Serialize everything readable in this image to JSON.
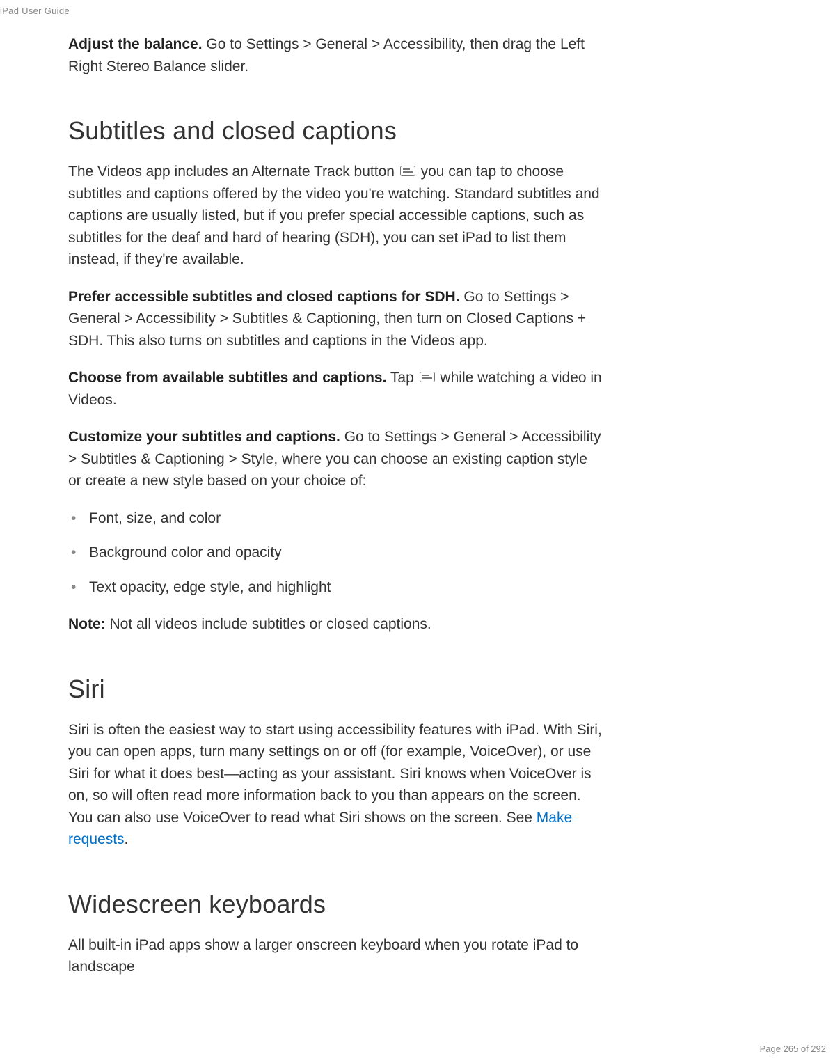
{
  "header": {
    "guide_label": "iPad User Guide"
  },
  "intro": {
    "adjust_balance_bold": "Adjust the balance.",
    "adjust_balance_text": " Go to Settings > General > Accessibility, then drag the Left Right Stereo Balance slider."
  },
  "section_subtitles": {
    "heading": "Subtitles and closed captions",
    "p1_a": "The Videos app includes an Alternate Track button ",
    "p1_b": " you can tap to choose subtitles and captions offered by the video you're watching. Standard subtitles and captions are usually listed, but if you prefer special accessible captions, such as subtitles for the deaf and hard of hearing (SDH), you can set iPad to list them instead, if they're available.",
    "p2_bold": "Prefer accessible subtitles and closed captions for SDH.",
    "p2_text": " Go to Settings > General > Accessibility > Subtitles & Captioning, then turn on Closed Captions + SDH. This also turns on subtitles and captions in the Videos app.",
    "p3_bold": "Choose from available subtitles and captions.",
    "p3_a": " Tap ",
    "p3_b": " while watching a video in Videos.",
    "p4_bold": "Customize your subtitles and captions.",
    "p4_text": " Go to Settings > General > Accessibility > Subtitles & Captioning > Style, where you can choose an existing caption style or create a new style based on your choice of:",
    "bullets": [
      "Font, size, and color",
      "Background color and opacity",
      "Text opacity, edge style, and highlight"
    ],
    "note_bold": "Note:",
    "note_text": " Not all videos include subtitles or closed captions."
  },
  "section_siri": {
    "heading": "Siri",
    "p1_a": "Siri is often the easiest way to start using accessibility features with iPad. With Siri, you can open apps, turn many settings on or off (for example, VoiceOver), or use Siri for what it does best—acting as your assistant. Siri knows when VoiceOver is on, so will often read more information back to you than appears on the screen. You can also use VoiceOver to read what Siri shows on the screen. See ",
    "link_text": "Make requests",
    "p1_b": "."
  },
  "section_keyboards": {
    "heading": "Widescreen keyboards",
    "p1": "All built-in iPad apps show a larger onscreen keyboard when you rotate iPad to landscape"
  },
  "footer": {
    "page_indicator": "Page 265 of 292"
  }
}
